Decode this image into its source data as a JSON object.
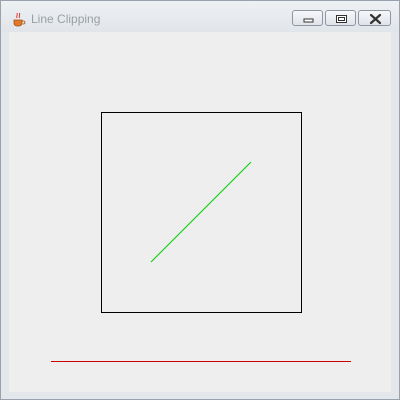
{
  "window": {
    "title": "Line Clipping",
    "icon": "java-cup-icon"
  },
  "caption_buttons": [
    "minimize-icon",
    "maximize-icon",
    "close-icon"
  ],
  "colors": {
    "client_background": "#eeeeee",
    "clip_rectangle": "#000000",
    "clipped_line_inside": "#00cc00",
    "reference_line": "#cc0000"
  }
}
